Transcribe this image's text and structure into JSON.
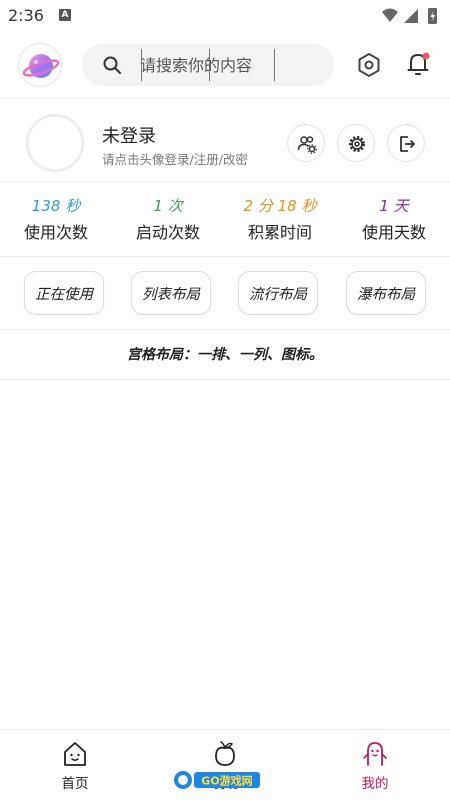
{
  "status_bar": {
    "time": "2:36",
    "badge": "A"
  },
  "search": {
    "placeholder": "请搜索你的内容"
  },
  "profile": {
    "name": "未登录",
    "hint": "请点击头像登录/注册/改密"
  },
  "stats": [
    {
      "value": "138 秒",
      "label": "使用次数",
      "color": "#2f9bd4"
    },
    {
      "value": "1 次",
      "label": "启动次数",
      "color": "#3aa55a"
    },
    {
      "value": "2 分 18 秒",
      "label": "积累时间",
      "color": "#e5911c"
    },
    {
      "value": "1 天",
      "label": "使用天数",
      "color": "#8b2ca8"
    }
  ],
  "layouts": [
    {
      "label": "正在使用"
    },
    {
      "label": "列表布局"
    },
    {
      "label": "流行布局"
    },
    {
      "label": "瀑布布局"
    }
  ],
  "grid_note": "宫格布局：一排、一列、图标。",
  "bottom_nav": [
    {
      "label": "首页",
      "icon": "home-icon",
      "active": false
    },
    {
      "label": "发现",
      "icon": "peach-icon",
      "active": false
    },
    {
      "label": "我的",
      "icon": "mascot-icon",
      "active": true
    }
  ],
  "watermark": {
    "text": "GO游戏网"
  },
  "colors": {
    "accent": "#c2185b",
    "notification_dot": "#f05a5a"
  }
}
